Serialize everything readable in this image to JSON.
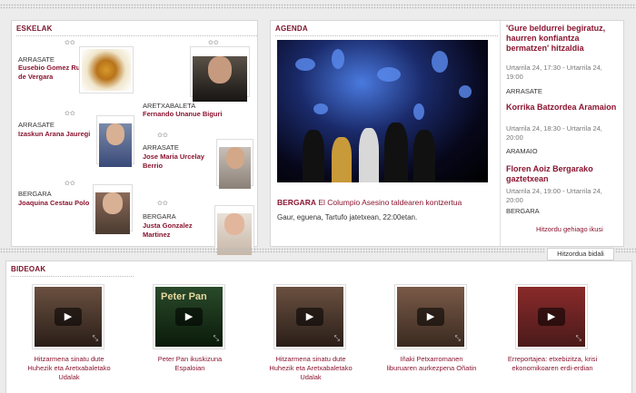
{
  "eskelak": {
    "title": "ESKELAK",
    "items": [
      {
        "town": "ARRASATE",
        "name": "Eusebio Gomez Ruiz de Vergara",
        "image": "flower-photo"
      },
      {
        "town": "",
        "name": "",
        "image": "man-portrait-1"
      },
      {
        "town": "ARETXABALETA",
        "name": "Fernando Unanue Biguri",
        "image": ""
      },
      {
        "town": "ARRASATE",
        "name": "Izaskun Arana Jauregi",
        "image": "woman-portrait-1"
      },
      {
        "town": "ARRASATE",
        "name": "Jose Maria Urcelay Berrio",
        "image": "man-portrait-2"
      },
      {
        "town": "BERGARA",
        "name": "Joaquina Cestau Polo",
        "image": "woman-portrait-2"
      },
      {
        "town": "BERGARA",
        "name": "Justa Gonzalez Martinez",
        "image": "woman-portrait-3"
      }
    ]
  },
  "agenda": {
    "title": "AGENDA",
    "featured": {
      "town": "BERGARA",
      "title": "El Columpio Asesino taldearen kontzertua",
      "desc": "Gaur, eguena, Tartufo jatetxean, 22:00etan."
    },
    "events": [
      {
        "title": "'Gure beldurrei begiratuz, haurren konfiantza bermatzen' hitzaldia",
        "date": "Urtarrila 24, 17:30 - Urtarrila 24, 19:00",
        "town": "ARRASATE"
      },
      {
        "title": "Korrika Batzordea Aramaion",
        "date": "Urtarrila 24, 18:30 - Urtarrila 24, 20:00",
        "town": "ARAMAIO"
      },
      {
        "title": "Floren Aoiz Bergarako gaztetxean",
        "date": "Urtarrila 24, 19:00 - Urtarrila 24, 20:00",
        "town": "BERGARA"
      }
    ],
    "more_link": "Hitzordu gehiago ikusi",
    "send_button": "Hitzordua bidali"
  },
  "bideoak": {
    "title": "BIDEOAK",
    "videos": [
      {
        "caption": "Hitzarmena sinatu dute Huhezik eta Aretxabaletako Udalak",
        "thumb": "meeting"
      },
      {
        "caption": "Peter Pan ikuskizuna Espaloian",
        "thumb": "peterpan",
        "poster_text": "Peter Pan"
      },
      {
        "caption": "Hitzarmena sinatu dute Huhezik eta Aretxabaletako Udalak",
        "thumb": "meeting"
      },
      {
        "caption": "Iñaki Petxarromanen liburuaren aurkezpena Oñatin",
        "thumb": "talk"
      },
      {
        "caption": "Erreportajea: etxebizitza, krisi ekonomikoaren erdi-erdian",
        "thumb": "interview"
      }
    ]
  },
  "colors": {
    "accent": "#8a1530",
    "panel_bg": "#ffffff",
    "page_bg": "#ececec"
  },
  "icons": {
    "play": "play-icon",
    "fullscreen": "fullscreen-icon",
    "ornament": "ornament-icon"
  }
}
